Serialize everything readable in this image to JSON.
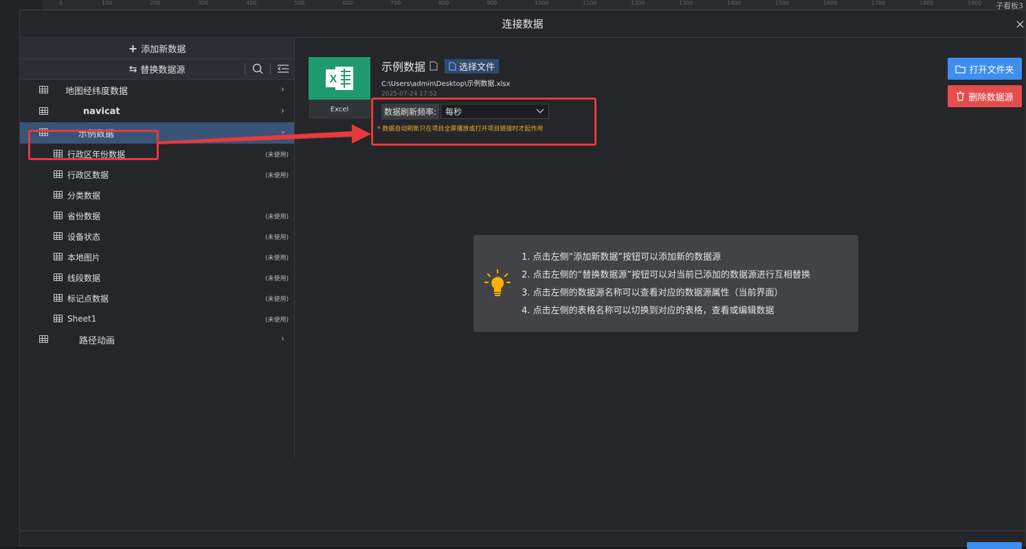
{
  "background": {
    "ruler_ticks": [
      "0",
      "100",
      "200",
      "300",
      "400",
      "500",
      "600",
      "700",
      "800",
      "900",
      "1000",
      "1100",
      "1200",
      "1300",
      "1400",
      "1500",
      "1600",
      "1700",
      "1800",
      "1900"
    ],
    "right_label": "子看板3"
  },
  "dialog": {
    "title": "连接数据",
    "close_icon": "×"
  },
  "sidebar": {
    "add_label": "添加新数据",
    "swap_label": "替换数据源",
    "datasources": [
      {
        "label": "地图经纬度数据"
      },
      {
        "label": "navicat"
      },
      {
        "label": "示例数据"
      }
    ],
    "sheets": [
      {
        "label": "行政区年份数据",
        "badge": "(未使用)"
      },
      {
        "label": "行政区数据",
        "badge": "(未使用)"
      },
      {
        "label": "分类数据",
        "badge": ""
      },
      {
        "label": "省份数据",
        "badge": "(未使用)"
      },
      {
        "label": "设备状态",
        "badge": "(未使用)"
      },
      {
        "label": "本地图片",
        "badge": "(未使用)"
      },
      {
        "label": "线段数据",
        "badge": "(未使用)"
      },
      {
        "label": "标记点数据",
        "badge": "(未使用)"
      },
      {
        "label": "Sheet1",
        "badge": "(未使用)"
      }
    ],
    "last_datasource": {
      "label": "路径动画"
    }
  },
  "detail": {
    "excel_label": "Excel",
    "title": "示例数据",
    "choose_file": "选择文件",
    "path": "C:\\Users\\admin\\Desktop\\示例数据.xlsx",
    "date": "2025-07-24 17:52",
    "refresh_label": "数据刷新频率:",
    "refresh_value": "每秒",
    "refresh_note": "* 数据自动刷新只在项目全屏播放或打开项目链接时才起作用",
    "open_folder": "打开文件夹",
    "delete_source": "删除数据源"
  },
  "tips": [
    "1. 点击左侧“添加新数据”按钮可以添加新的数据源",
    "2. 点击左侧的“替换数据源”按钮可以对当前已添加的数据源进行互相替换",
    "3. 点击左侧的数据源名称可以查看对应的数据源属性（当前界面）",
    "4. 点击左侧的表格名称可以切换到对应的表格，查看或编辑数据"
  ],
  "colors": {
    "accent_blue": "#3d8ef0",
    "danger_red": "#e54d4d",
    "excel_green": "#1f9a6e",
    "annotation_red": "#e83a3a",
    "note_orange": "#f0a828"
  }
}
